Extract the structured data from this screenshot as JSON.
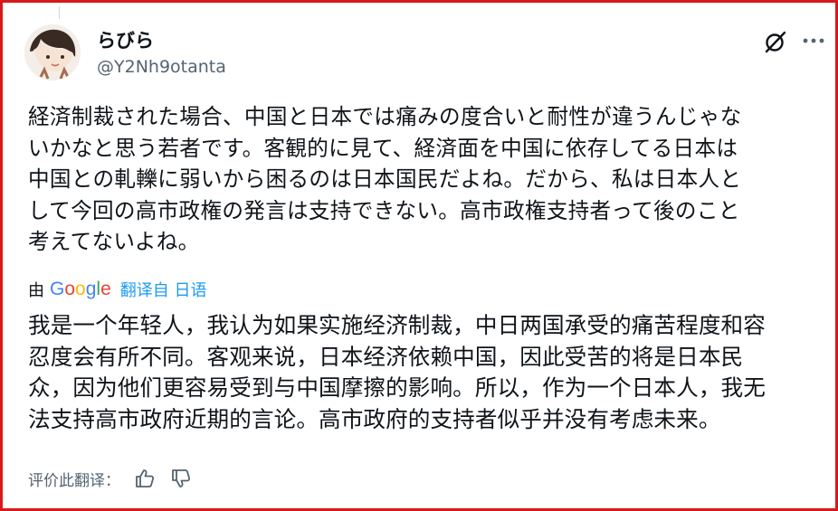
{
  "post": {
    "author": {
      "display_name": "らびら",
      "handle": "@Y2Nh9otanta"
    },
    "original_lines": [
      "経済制裁された場合、中国と日本では痛みの度合いと耐性が違うんじゃな",
      "いかなと思う若者です。客観的に見て、経済面を中国に依存してる日本は",
      "中国との軋轢に弱いから困るのは日本国民だよね。だから、私は日本人と",
      "して今回の高市政権の発言は支持できない。高市政権支持者って後のこと",
      "考えてないよね。"
    ],
    "translation": {
      "by_label": "由",
      "provider": "Google",
      "link_text": "翻译自 日语",
      "lines": [
        "我是一个年轻人，我认为如果实施经济制裁，中日两国承受的痛苦程度和容",
        "忍度会有所不同。客观来说，日本经济依赖中国，因此受苦的将是日本民",
        "众，因为他们更容易受到与中国摩擦的影响。所以，作为一个日本人，我无",
        "法支持高市政府近期的言论。高市政府的支持者似乎并没有考虑未来。"
      ],
      "rate_label": "评价此翻译："
    }
  },
  "icons": {
    "avatar": "avatar-illustration",
    "grok": "grok-slash-icon",
    "more": "more-icon",
    "thumb_up": "thumbs-up-icon",
    "thumb_down": "thumbs-down-icon"
  },
  "colors": {
    "border": "#d61a1a",
    "text": "#0f1419",
    "muted": "#536471",
    "link": "#1d9bf0",
    "google_blue": "#4285f4",
    "google_red": "#ea4335",
    "google_yellow": "#fbbc05",
    "google_green": "#34a853"
  }
}
